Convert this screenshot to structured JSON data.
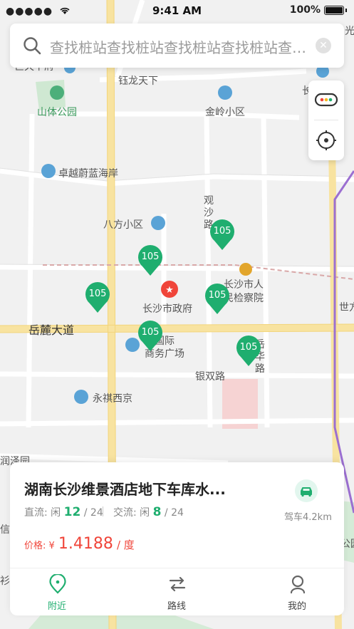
{
  "status_bar": {
    "signal": "●●●●●",
    "time": "9:41 AM",
    "battery": "100%"
  },
  "search": {
    "placeholder": "查找桩站查找桩站查找桩站查找桩站查找桩站"
  },
  "map": {
    "labels": {
      "shanti_park": "山体公园",
      "yulong": "钰龙天下",
      "jinling": "金岭小区",
      "zhuoyue": "卓越蔚蓝海岸",
      "bafang": "八方小区",
      "guansha": "观沙路",
      "govt": "长沙市政府",
      "procuratorate_1": "长沙市人",
      "procuratorate_2": "民检察院",
      "yuelu_road": "岳麓大道",
      "business_1": "通国际",
      "business_2": "商务广场",
      "yinshuang": "银双路",
      "yongqi": "永祺西京",
      "zhenghua": "岳华路",
      "shiji": "世方",
      "edge_top_left": "巨天下府",
      "edge_top_right": "光",
      "edge_right_chang": "长",
      "edge_left_1": "润泽园",
      "edge_left_2": "信",
      "edge_left_3": "衫",
      "edge_right_park": "公园"
    },
    "pins": [
      "105",
      "105",
      "105",
      "105",
      "105",
      "105"
    ]
  },
  "station_card": {
    "title": "湖南长沙维景酒店地下车库水...",
    "dc_label": "直流: 闲",
    "dc_free": "12",
    "dc_total": "/ 24",
    "ac_label": "交流: 闲",
    "ac_free": "8",
    "ac_total": "/ 24",
    "price_label": "价格: ¥",
    "price_value": "1.4188",
    "price_unit": "/ 度",
    "distance": "驾车4.2km"
  },
  "tabs": [
    {
      "label": "附近",
      "icon": "location-pin-icon",
      "active": true
    },
    {
      "label": "路线",
      "icon": "route-arrows-icon",
      "active": false
    },
    {
      "label": "我的",
      "icon": "user-icon",
      "active": false
    }
  ],
  "colors": {
    "accent": "#1fae6f",
    "price": "#f0453a",
    "pin": "#1fae6f"
  }
}
